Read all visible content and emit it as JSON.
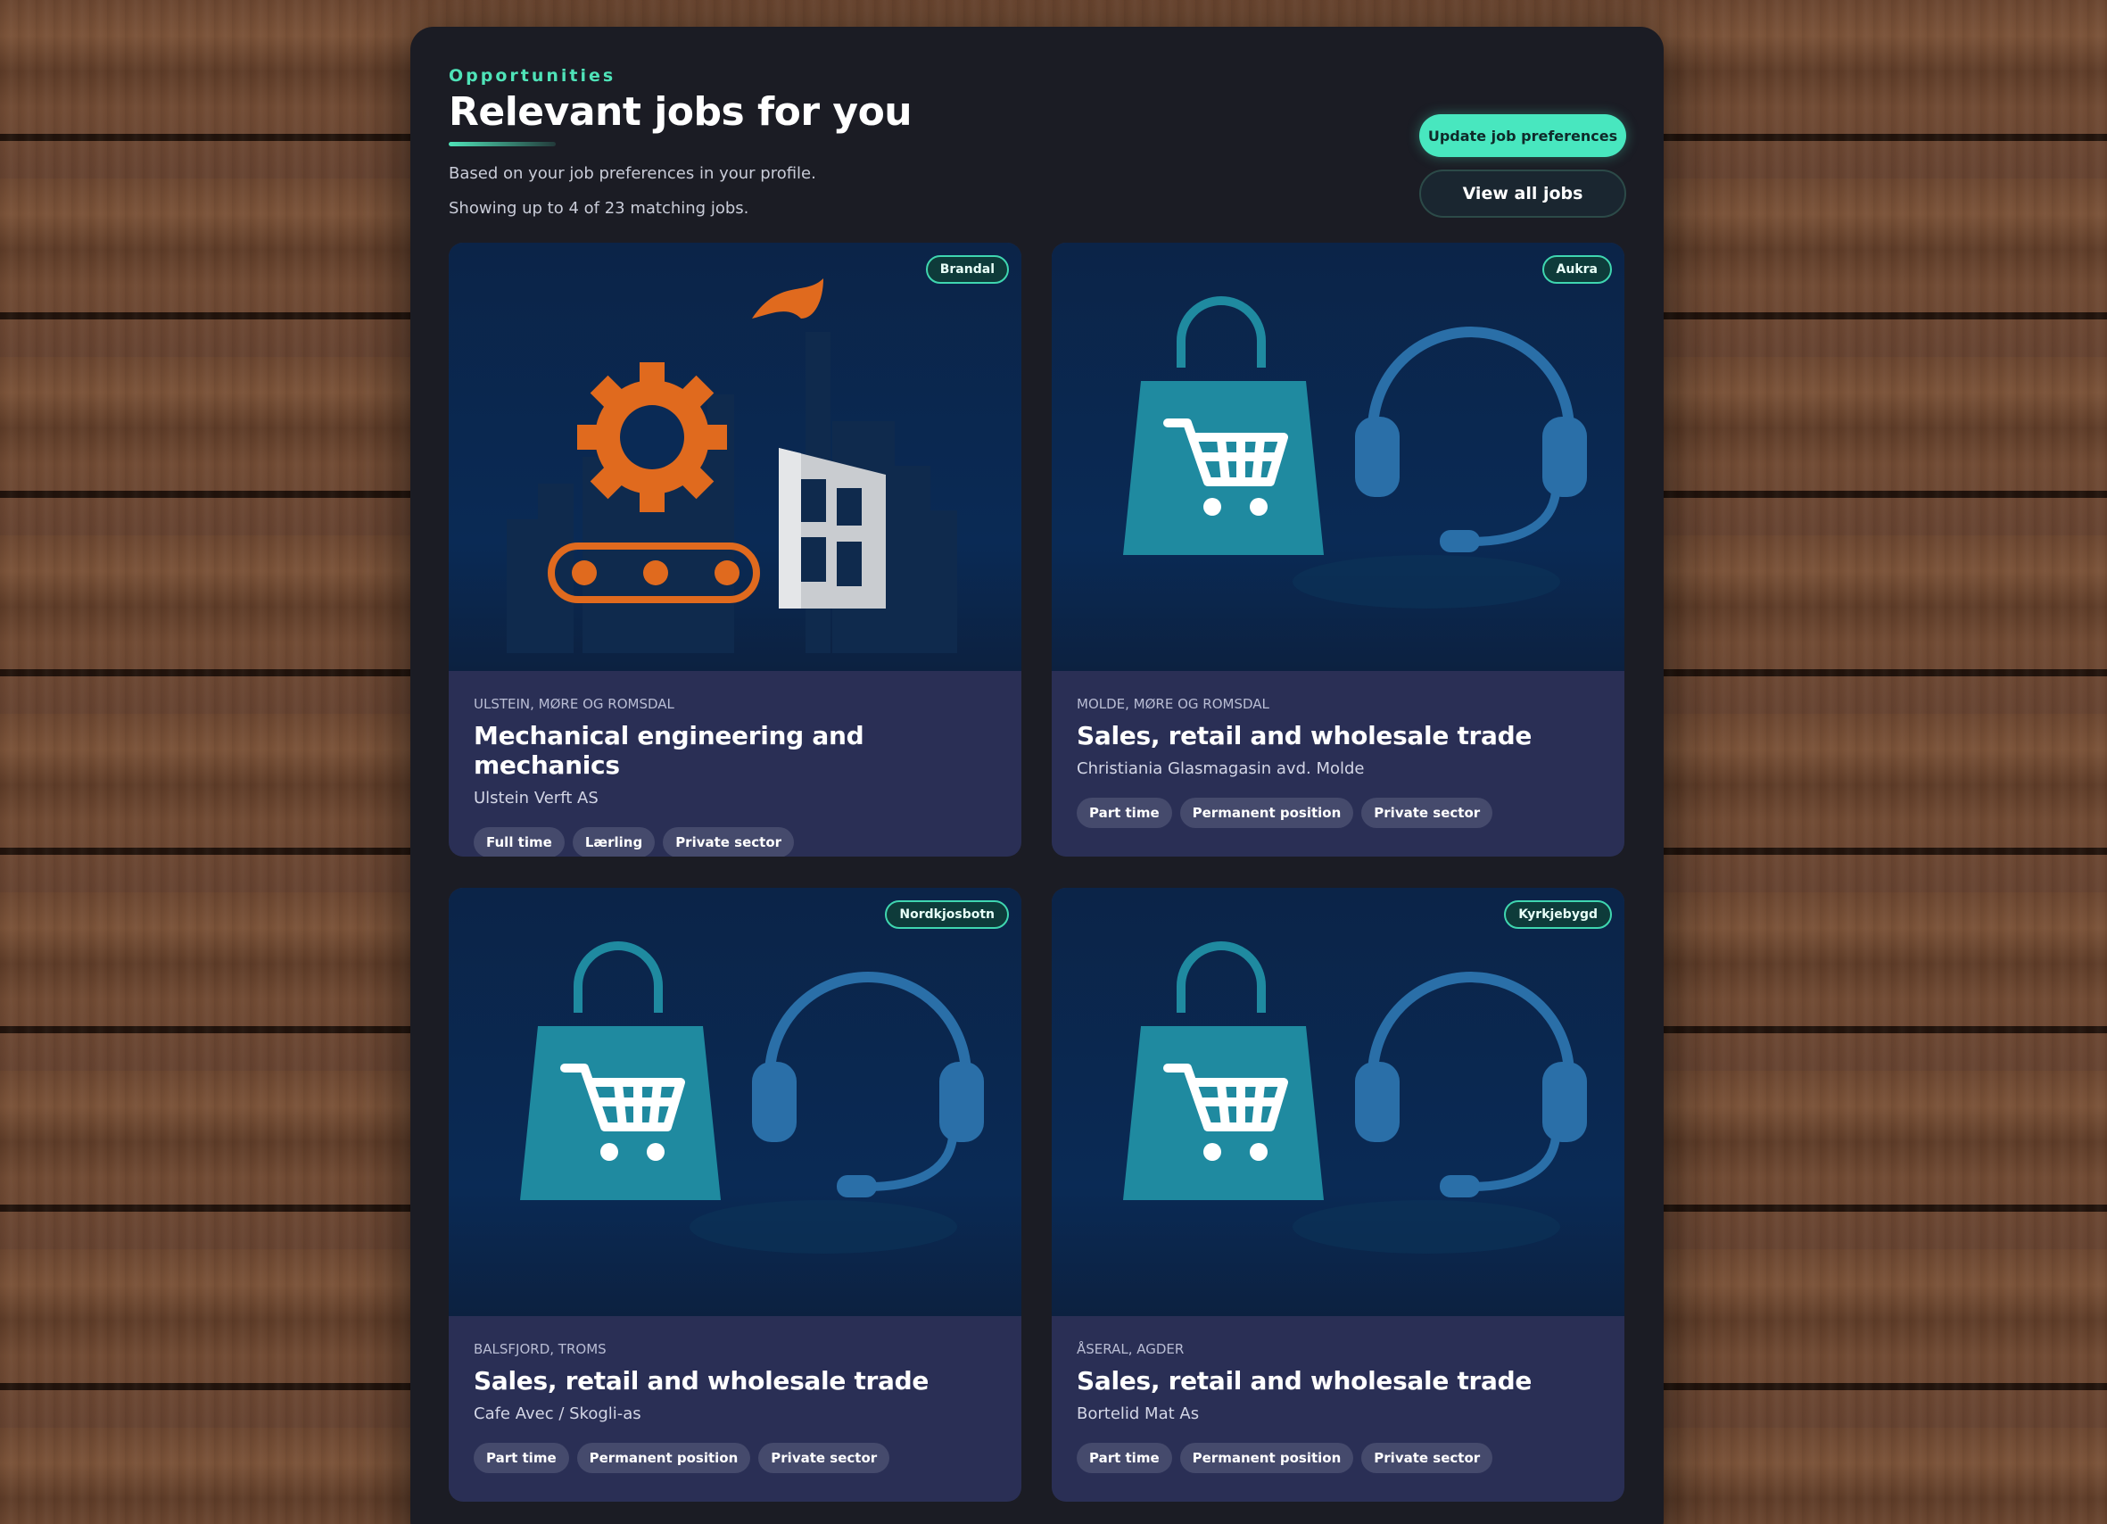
{
  "header": {
    "eyebrow": "Opportunities",
    "title": "Relevant jobs for you",
    "description": "Based on your job preferences in your profile.",
    "count_text": "Showing up to 4 of 23 matching jobs.",
    "update_button": "Update job preferences",
    "view_all_button": "View all jobs"
  },
  "colors": {
    "accent": "#48e7bf",
    "panel": "#1b1c24",
    "card_body": "#2a2f55",
    "art_orange": "#e06a1e",
    "art_teal": "#1f8aa0"
  },
  "jobs": [
    {
      "badge": "Brandal",
      "region": "ULSTEIN, MØRE OG ROMSDAL",
      "title": "Mechanical engineering and mechanics",
      "company": "Ulstein Verft AS",
      "tags": [
        "Full time",
        "Lærling",
        "Private sector"
      ],
      "illustration": "factory-gear-icon"
    },
    {
      "badge": "Aukra",
      "region": "MOLDE, MØRE OG ROMSDAL",
      "title": "Sales, retail and wholesale trade",
      "company": "Christiania Glasmagasin avd. Molde",
      "tags": [
        "Part time",
        "Permanent position",
        "Private sector"
      ],
      "illustration": "shopping-bag-headset-icon"
    },
    {
      "badge": "Nordkjosbotn",
      "region": "BALSFJORD, TROMS",
      "title": "Sales, retail and wholesale trade",
      "company": "Cafe Avec / Skogli-as",
      "tags": [
        "Part time",
        "Permanent position",
        "Private sector"
      ],
      "illustration": "shopping-bag-headset-icon"
    },
    {
      "badge": "Kyrkjebygd",
      "region": "ÅSERAL, AGDER",
      "title": "Sales, retail and wholesale trade",
      "company": "Bortelid Mat As",
      "tags": [
        "Part time",
        "Permanent position",
        "Private sector"
      ],
      "illustration": "shopping-bag-headset-icon"
    }
  ]
}
